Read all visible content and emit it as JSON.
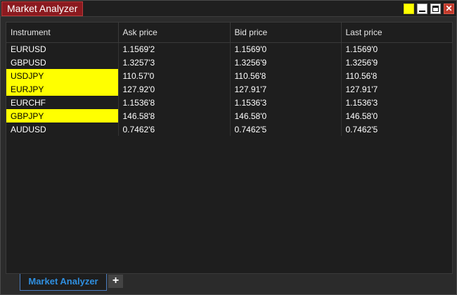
{
  "window": {
    "title": "Market Analyzer",
    "highlight_color": "#ffff00",
    "close_glyph": "✕"
  },
  "grid": {
    "columns": [
      "Instrument",
      "Ask price",
      "Bid price",
      "Last price"
    ],
    "rows": [
      {
        "instrument": "EURUSD",
        "ask": "1.1569'2",
        "bid": "1.1569'0",
        "last": "1.1569'0",
        "highlighted": false
      },
      {
        "instrument": "GBPUSD",
        "ask": "1.3257'3",
        "bid": "1.3256'9",
        "last": "1.3256'9",
        "highlighted": false
      },
      {
        "instrument": "USDJPY",
        "ask": "110.57'0",
        "bid": "110.56'8",
        "last": "110.56'8",
        "highlighted": true
      },
      {
        "instrument": "EURJPY",
        "ask": "127.92'0",
        "bid": "127.91'7",
        "last": "127.91'7",
        "highlighted": true
      },
      {
        "instrument": "EURCHF",
        "ask": "1.1536'8",
        "bid": "1.1536'3",
        "last": "1.1536'3",
        "highlighted": false
      },
      {
        "instrument": "GBPJPY",
        "ask": "146.58'8",
        "bid": "146.58'0",
        "last": "146.58'0",
        "highlighted": true
      },
      {
        "instrument": "AUDUSD",
        "ask": "0.7462'6",
        "bid": "0.7462'5",
        "last": "0.7462'5",
        "highlighted": false
      }
    ]
  },
  "tabs": {
    "active_label": "Market Analyzer",
    "add_label": "+"
  }
}
